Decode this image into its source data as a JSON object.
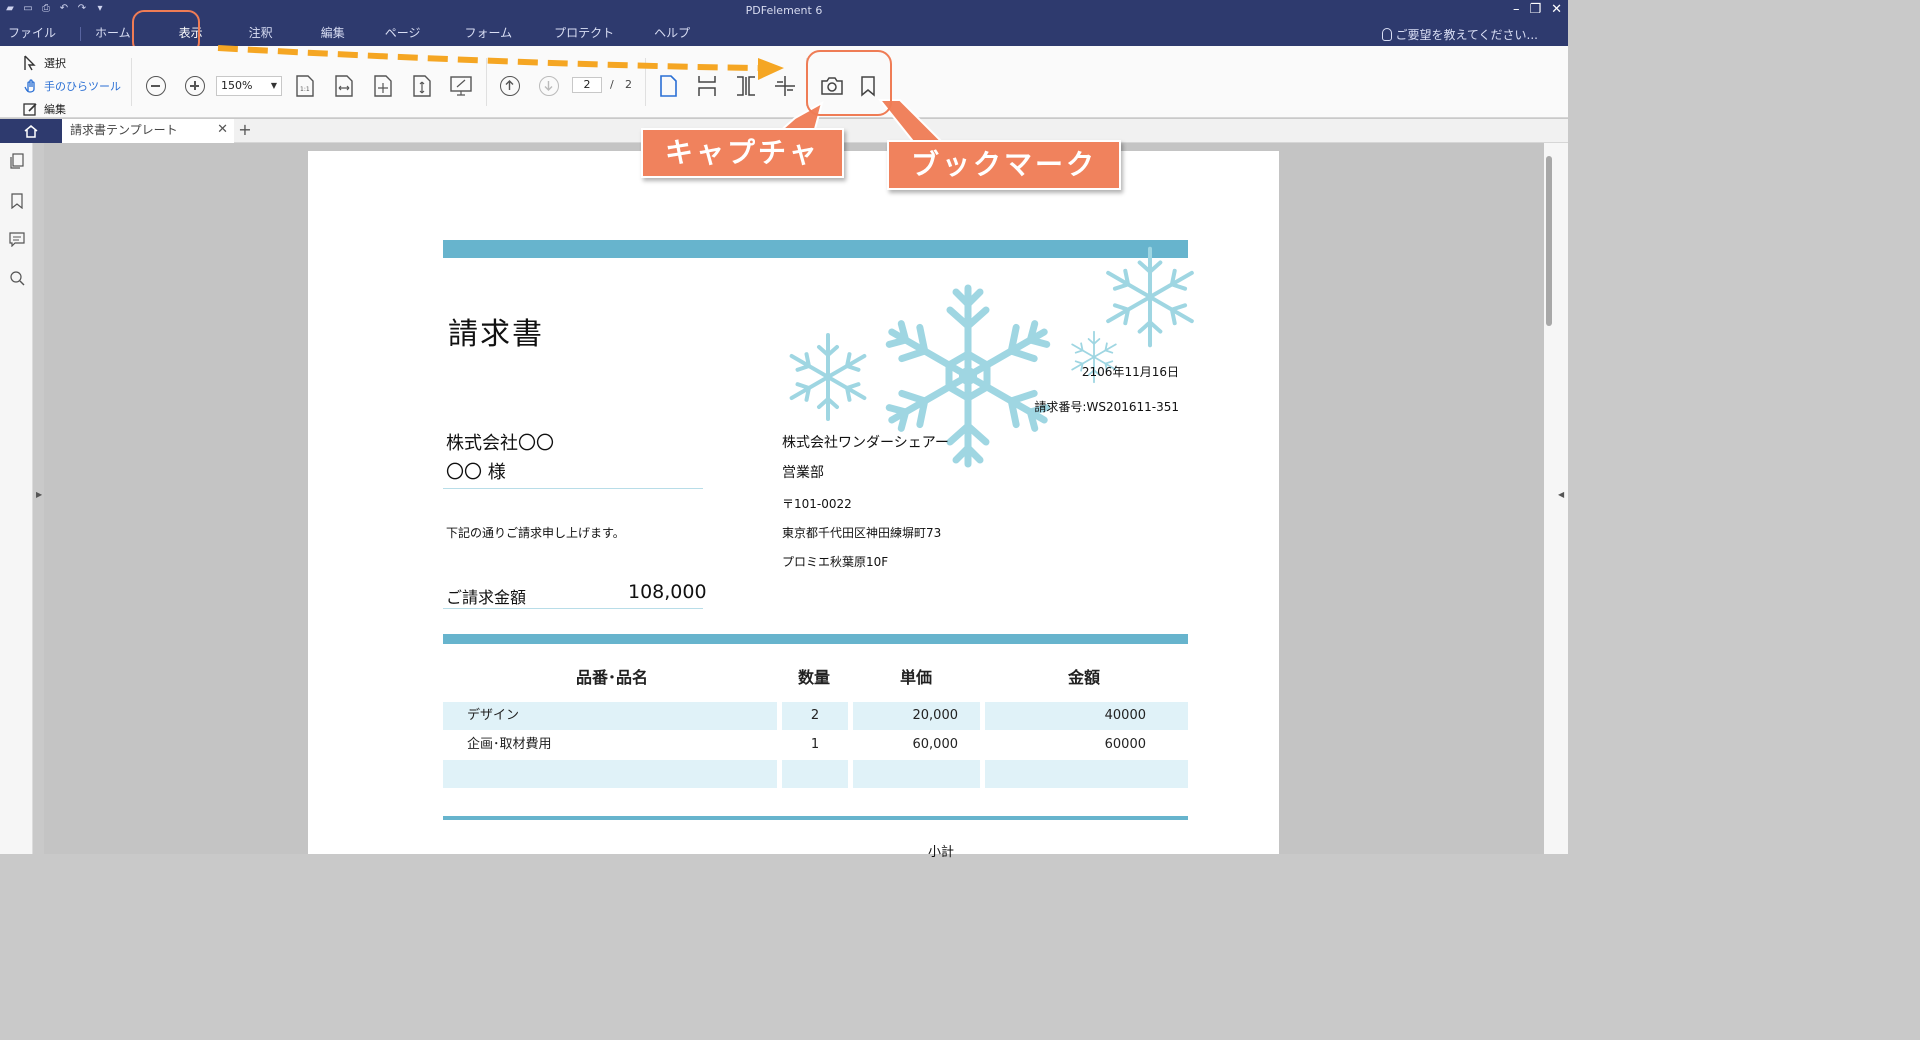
{
  "window": {
    "title": "PDFelement 6"
  },
  "menu": {
    "items": [
      "ファイル",
      "ホーム",
      "表示",
      "注釈",
      "編集",
      "ページ",
      "フォーム",
      "プロテクト",
      "ヘルプ"
    ],
    "active": "表示",
    "hint": "ご要望を教えてください..."
  },
  "ribbon": {
    "tools": [
      {
        "label": "選択",
        "icon": "select-cursor-icon"
      },
      {
        "label": "手のひらツール",
        "icon": "hand-tool-icon"
      },
      {
        "label": "編集",
        "icon": "edit-icon"
      }
    ],
    "zoom": "150%",
    "current_page": "2",
    "page_sep": "/",
    "total_pages": "2"
  },
  "tabs": {
    "document": "請求書テンプレート"
  },
  "annotations": {
    "capture": "キャプチャ",
    "bookmark": "ブックマーク",
    "accent": "#f0825d",
    "arrow": "#f5a623"
  },
  "invoice": {
    "title": "請求書",
    "date": "2106年11月16日",
    "invoice_no": "請求番号:WS201611-351",
    "client_company": "株式会社〇〇",
    "client_person": "〇〇 様",
    "intro": "下記の通りご請求申し上げます。",
    "amount_label": "ご請求金額",
    "amount_value": "108,000",
    "issuer_company": "株式会社ワンダーシェアー",
    "issuer_dept": "営業部",
    "issuer_zip": "〒101-0022",
    "issuer_addr1": "東京都千代田区神田練塀町73",
    "issuer_addr2": "プロミエ秋葉原10F",
    "table_headers": [
      "品番･品名",
      "数量",
      "単価",
      "金額"
    ],
    "rows": [
      {
        "name": "デザイン",
        "qty": "2",
        "price": "20,000",
        "amount": "40000"
      },
      {
        "name": "企画･取材費用",
        "qty": "1",
        "price": "60,000",
        "amount": "60000"
      },
      {
        "name": "",
        "qty": "",
        "price": "",
        "amount": ""
      }
    ],
    "footer_partial": "小計",
    "band_color": "#67b4cd",
    "snow_color": "#9fd6e2"
  }
}
